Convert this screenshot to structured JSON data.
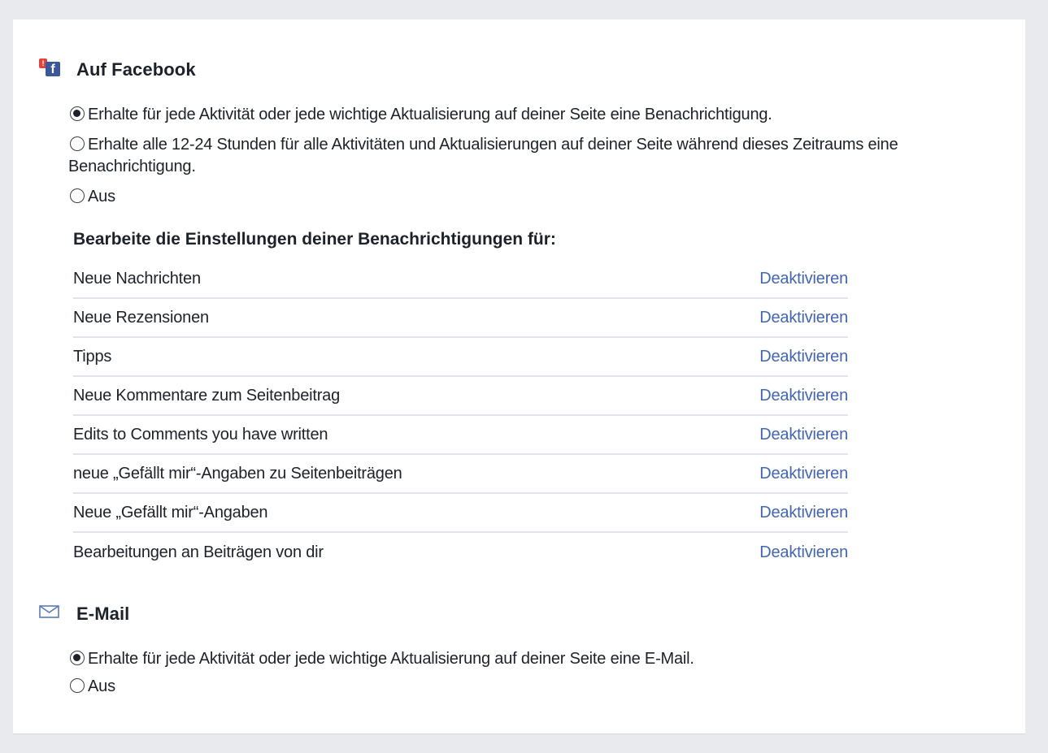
{
  "facebook_section": {
    "title": "Auf Facebook",
    "icon": "facebook-notification-icon",
    "badge": "!",
    "options": [
      {
        "label": "Erhalte für jede Aktivität oder jede wichtige Aktualisierung auf deiner Seite eine Benachrichtigung.",
        "selected": true
      },
      {
        "label": "Erhalte alle 12-24 Stunden für alle Aktivitäten und Aktualisierungen auf deiner Seite während dieses Zeitraums eine Benachrichtigung.",
        "selected": false
      },
      {
        "label": "Aus",
        "selected": false
      }
    ],
    "subheading": "Bearbeite die Einstellungen deiner Benachrichtigungen für:",
    "items": [
      {
        "label": "Neue Nachrichten",
        "action": "Deaktivieren"
      },
      {
        "label": "Neue Rezensionen",
        "action": "Deaktivieren"
      },
      {
        "label": "Tipps",
        "action": "Deaktivieren"
      },
      {
        "label": "Neue Kommentare zum Seitenbeitrag",
        "action": "Deaktivieren"
      },
      {
        "label": "Edits to Comments you have written",
        "action": "Deaktivieren"
      },
      {
        "label": "neue „Gefällt mir“-Angaben zu Seitenbeiträgen",
        "action": "Deaktivieren"
      },
      {
        "label": "Neue „Gefällt mir“-Angaben",
        "action": "Deaktivieren"
      },
      {
        "label": "Bearbeitungen an Beiträgen von dir",
        "action": "Deaktivieren"
      }
    ]
  },
  "email_section": {
    "title": "E-Mail",
    "icon": "envelope-icon",
    "options": [
      {
        "label": "Erhalte für jede Aktivität oder jede wichtige Aktualisierung auf deiner Seite eine E-Mail.",
        "selected": true
      },
      {
        "label": "Aus",
        "selected": false
      }
    ]
  },
  "colors": {
    "link": "#4267b2",
    "text": "#1d2129",
    "facebook_blue": "#3b5998",
    "background": "#e9eaed"
  }
}
